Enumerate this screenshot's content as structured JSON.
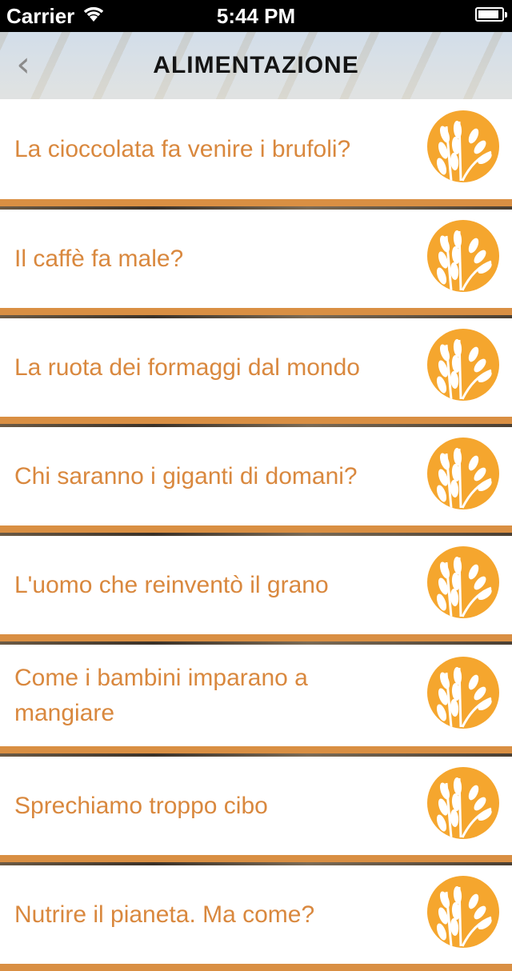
{
  "status_bar": {
    "carrier": "Carrier",
    "time": "5:44 PM",
    "battery_level": 0.9
  },
  "nav": {
    "back_icon": "chevron-left-icon",
    "title": "ALIMENTAZIONE"
  },
  "colors": {
    "accent": "#d9883e",
    "icon_bg": "#f5a62e",
    "separator": "#d98f43"
  },
  "items": [
    {
      "label": "La cioccolata fa venire i brufoli?",
      "icon": "wheat-icon"
    },
    {
      "label": "Il caffè fa male?",
      "icon": "wheat-icon"
    },
    {
      "label": "La ruota dei formaggi dal mondo",
      "icon": "wheat-icon"
    },
    {
      "label": "Chi saranno i giganti di domani?",
      "icon": "wheat-icon"
    },
    {
      "label": "L'uomo che reinventò il grano",
      "icon": "wheat-icon"
    },
    {
      "label": "Come i bambini imparano a mangiare",
      "icon": "wheat-icon"
    },
    {
      "label": "Sprechiamo troppo cibo",
      "icon": "wheat-icon"
    },
    {
      "label": "Nutrire il pianeta. Ma come?",
      "icon": "wheat-icon"
    }
  ]
}
